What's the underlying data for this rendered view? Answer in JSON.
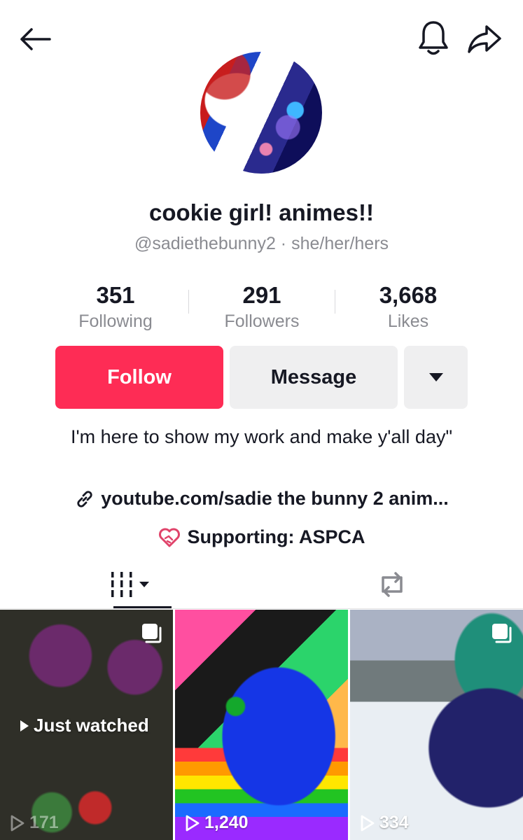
{
  "header": {
    "back_icon": "arrow-left-icon",
    "notify_icon": "bell-icon",
    "share_icon": "share-arrow-icon"
  },
  "profile": {
    "display_name": "cookie girl! animes!!",
    "handle": "@sadiethebunny2 · she/her/hers"
  },
  "stats": [
    {
      "value": "351",
      "label": "Following"
    },
    {
      "value": "291",
      "label": "Followers"
    },
    {
      "value": "3,668",
      "label": "Likes"
    }
  ],
  "actions": {
    "follow_label": "Follow",
    "message_label": "Message",
    "more_icon": "caret-down-icon"
  },
  "bio": {
    "text": "I'm here to show my work and make y'all day\"",
    "link": "youtube.com/sadie the bunny 2 anim...",
    "supporting": "Supporting: ASPCA"
  },
  "tabs": [
    {
      "icon": "videos-grid-icon"
    },
    {
      "icon": "repost-icon"
    }
  ],
  "videos": [
    {
      "views": "171",
      "overlay": "Just watched"
    },
    {
      "views": "1,240"
    },
    {
      "views": "334"
    }
  ],
  "colors": {
    "accent": "#fe2c55",
    "secondary_bg": "#efeff0",
    "text_primary": "#161823",
    "text_muted": "#8a8b91"
  }
}
